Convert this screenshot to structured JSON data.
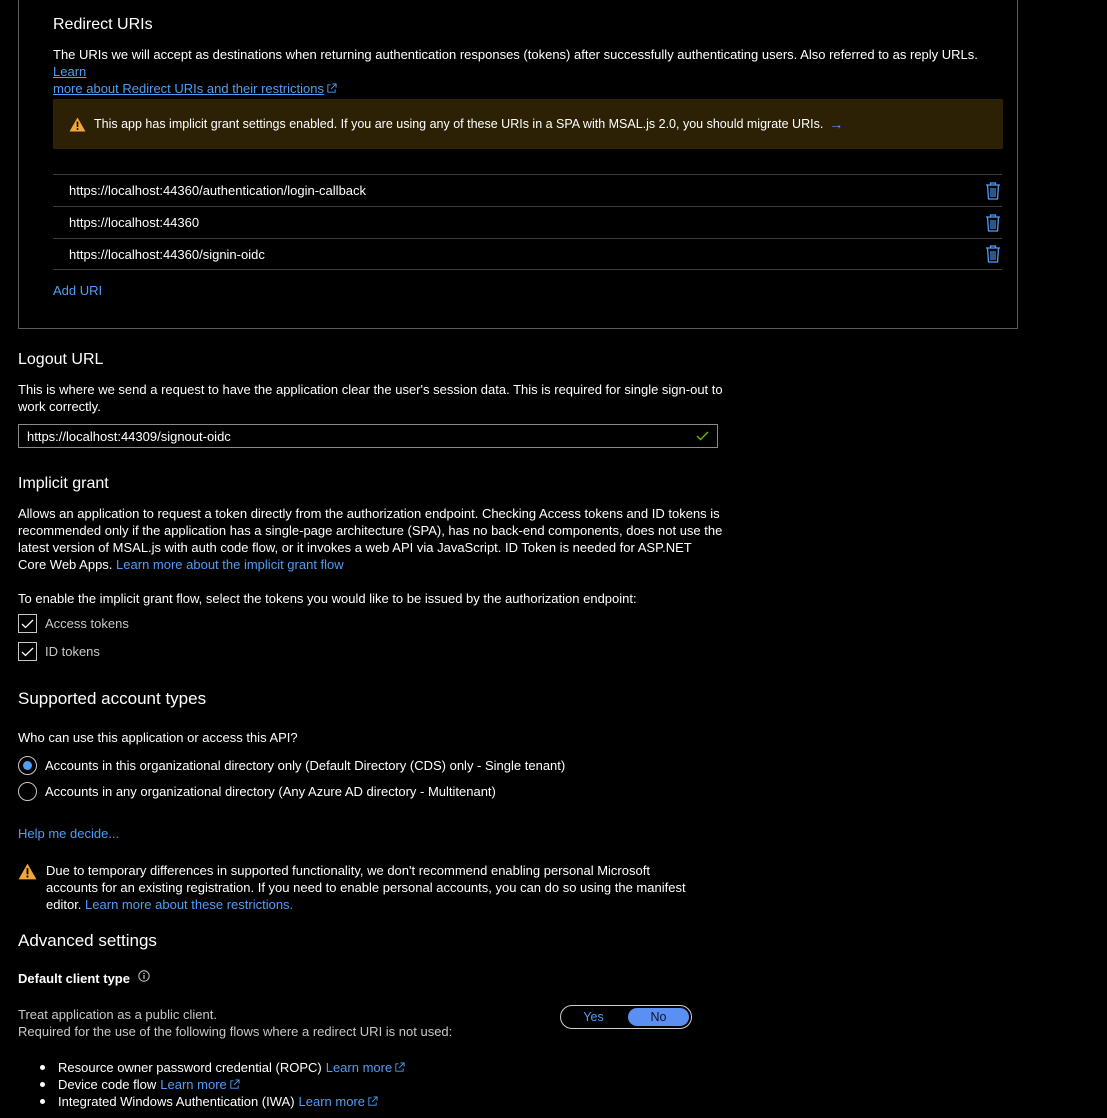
{
  "redirect": {
    "title": "Redirect URIs",
    "description": "The URIs we will accept as destinations when returning authentication responses (tokens) after successfully authenticating users. Also referred to as reply URLs.",
    "learn_more_1": "Learn",
    "learn_more_2": "more about Redirect URIs and their restrictions",
    "warning": "This app has implicit grant settings enabled. If you are using any of these URIs in a SPA with MSAL.js 2.0, you should migrate URIs.",
    "warning_arrow": "→",
    "uris": [
      "https://localhost:44360/authentication/login-callback",
      "https://localhost:44360",
      "https://localhost:44360/signin-oidc"
    ],
    "add_uri": "Add URI"
  },
  "logout": {
    "title": "Logout URL",
    "description": "This is where we send a request to have the application clear the user's session data. This is required for single sign-out to work correctly.",
    "value": "https://localhost:44309/signout-oidc"
  },
  "implicit": {
    "title": "Implicit grant",
    "description": "Allows an application to request a token directly from the authorization endpoint. Checking Access tokens and ID tokens is recommended only if the application has a single-page architecture (SPA), has no back-end components, does not use the latest version of MSAL.js with auth code flow, or it invokes a web API via JavaScript. ID Token is needed for ASP.NET Core Web Apps.",
    "learn_more": "Learn more about the implicit grant flow",
    "instruction": "To enable the implicit grant flow, select the tokens you would like to be issued by the authorization endpoint:",
    "access_tokens": "Access tokens",
    "id_tokens": "ID tokens"
  },
  "accounts": {
    "title": "Supported account types",
    "question": "Who can use this application or access this API?",
    "option_single": "Accounts in this organizational directory only (Default Directory (CDS) only - Single tenant)",
    "option_multi": "Accounts in any organizational directory (Any Azure AD directory - Multitenant)",
    "help": "Help me decide...",
    "warning": "Due to temporary differences in supported functionality, we don't recommend enabling personal Microsoft accounts for an existing registration. If you need to enable personal accounts, you can do so using the manifest editor.",
    "warning_link": "Learn more about these restrictions."
  },
  "advanced": {
    "title": "Advanced settings",
    "client_type": "Default client type",
    "public_client": "Treat application as a public client.",
    "required_for": "Required for the use of the following flows where a redirect URI is not used:",
    "toggle_yes": "Yes",
    "toggle_no": "No",
    "flows": [
      {
        "label": "Resource owner password credential (ROPC)",
        "link": "Learn more"
      },
      {
        "label": "Device code flow",
        "link": "Learn more"
      },
      {
        "label": "Integrated Windows Authentication (IWA)",
        "link": "Learn more"
      }
    ]
  },
  "colors": {
    "link": "#4f9df5",
    "warning_bg": "#2d2105",
    "warning_icon": "#f2a53a",
    "success_check": "#6bb700",
    "radio_selected": "#4f9df5"
  }
}
